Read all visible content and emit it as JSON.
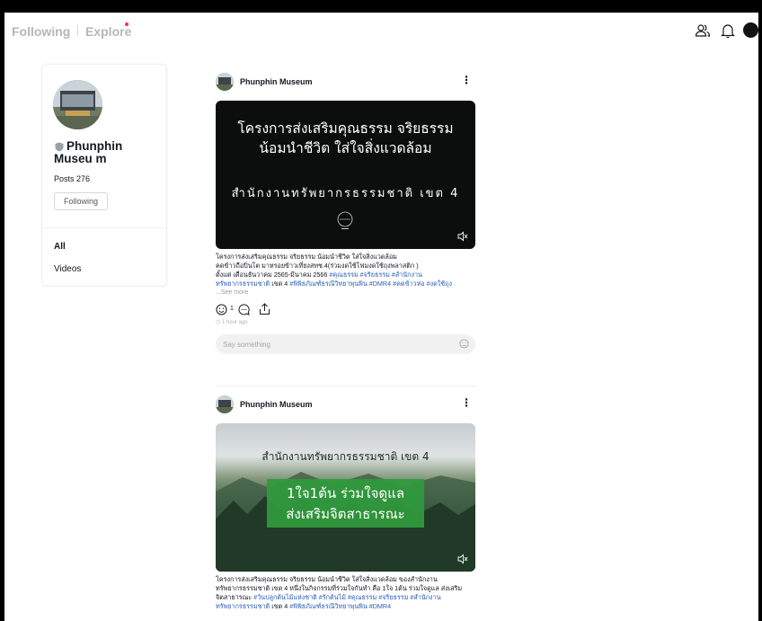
{
  "nav": {
    "following": "Following",
    "explore": "Explore"
  },
  "header_icons": [
    "friends-icon",
    "bell-icon",
    "user-avatar"
  ],
  "profile": {
    "name": "Phunphin Museu m",
    "posts_label": "Posts 276",
    "follow_button": "Following",
    "tabs": [
      "All",
      "Videos"
    ]
  },
  "posts": [
    {
      "author": "Phunphin Museum",
      "media": {
        "headline_1": "โครงการส่งเสริมคุณธรรม จริยธรรม",
        "headline_2": "น้อมนำชีวิต ใส่ใจสิ่งแวดล้อม",
        "subline": "สำนักงานทรัพยากรธรรมชาติ เขต 4"
      },
      "caption_lines": [
        "โครงการส่งเสริมคุณธรรม จริยธรรม น้อมนำชีวิต ใส่ใจสิ่งแวดล้อม",
        "คดข้าวถือปิ่นโต มาหรอยข้าวเที่ยงสทช.4(ร่วมงดใช้โฟมงดใช้ถุงพลาสติก )",
        "ตั้งแต่ เดือนธันวาคม 2565-มีนาคม 2566"
      ],
      "caption_tags_1": "#คุณธรรม #จริยธรรม #สำนักงาน",
      "caption_tags_2_prefix": "ทรัพยากรธรรมชาติ",
      "caption_line_4_mid": "เขต 4",
      "caption_tags_3": "#พิพิธภัณฑ์ธรณีวิทยาพุนพิน #DMR4 #คดข้าวห่อ #งดใช้ถุง",
      "see_more": "...See more",
      "reaction_count": "1",
      "time": "1 hour ago",
      "comment_placeholder": "Say something"
    },
    {
      "author": "Phunphin Museum",
      "media": {
        "headline_1": "สำนักงานทรัพยากรธรรมชาติ เขต 4",
        "banner_1": "1ใจ1ต้น ร่วมใจดูแล",
        "banner_2": "ส่งเสริมจิตสาธารณะ"
      },
      "caption_line_1": "โครงการส่งเสริมคุณธรรม จริยธรรม น้อมนำชีวิต ใส่ใจสิ่งแวดล้อม ของสำนักงาน",
      "caption_line_2": "ทรัพยากรธรรมชาติ เขต 4 หนึ่งในกิจกรรมที่ร่วมใจกันทำ คือ 1ใจ 1ต้น ร่วมใจดูแล ส่งเสริม",
      "caption_line_3_plain": "จิตสาธารณะ",
      "caption_line_3_tags": "#วันปลูกต้นไม้แห่งชาติ #รักต้นไม้ #คุณธรรม #จริยธรรม #สำนักงาน",
      "caption_line_4_tags_a": "ทรัพยากรธรรมชาติ",
      "caption_line_4_mid": "เขต 4",
      "caption_line_4_tags_b": "#พิพิธภัณฑ์ธรณีวิทยาพุนพิน #DMR4"
    }
  ],
  "colors": {
    "accent": "#fe2c55",
    "hashtag": "#2b5db9",
    "banner_green": "#2f9a3c"
  }
}
